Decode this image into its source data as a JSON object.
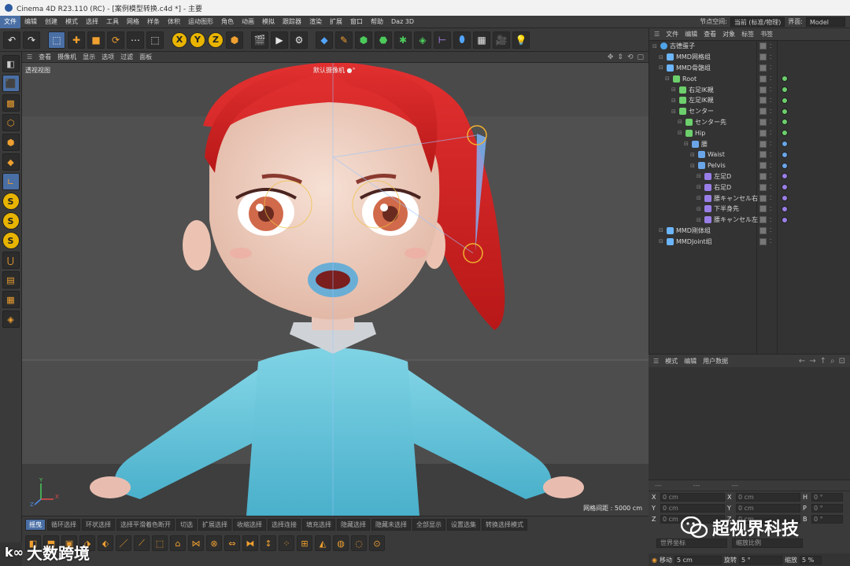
{
  "window": {
    "title": "Cinema 4D R23.110 (RC) - [案例模型转换.c4d *] - 主要"
  },
  "menu": {
    "items": [
      "文件",
      "编辑",
      "创建",
      "模式",
      "选择",
      "工具",
      "网格",
      "样条",
      "体积",
      "运动图形",
      "角色",
      "动画",
      "模拟",
      "跟踪器",
      "渲染",
      "扩展",
      "窗口",
      "帮助",
      "Daz 3D"
    ],
    "node_space_label": "节点空间:",
    "node_space_value": "当前 (标准/物理)",
    "layout_label": "界面:",
    "layout_value": "Model"
  },
  "viewport": {
    "menu": [
      "查看",
      "摄像机",
      "显示",
      "选项",
      "过滤",
      "面板"
    ],
    "label": "透视视图",
    "camera": "默认摄像机 ●°",
    "grid_info": "网格间距 : 5000 cm",
    "axis_y": "Y",
    "axis_x": "X",
    "axis_z": "Z"
  },
  "object_manager": {
    "menu": [
      "文件",
      "编辑",
      "查看",
      "对象",
      "标签",
      "书签"
    ],
    "rows": [
      {
        "label": "古德蛋子",
        "icon": "null",
        "indent": 0
      },
      {
        "label": "MMD网格组",
        "icon": "grp",
        "indent": 1
      },
      {
        "label": "MMD骨骼组",
        "icon": "grp",
        "indent": 1
      },
      {
        "label": "Root",
        "icon": "bone",
        "indent": 2
      },
      {
        "label": "右足IK親",
        "icon": "bone",
        "indent": 3
      },
      {
        "label": "左足IK親",
        "icon": "bone",
        "indent": 3
      },
      {
        "label": "センター",
        "icon": "bone",
        "indent": 3
      },
      {
        "label": "センター先",
        "icon": "bone",
        "indent": 4
      },
      {
        "label": "Hip",
        "icon": "bone",
        "indent": 4
      },
      {
        "label": "腰",
        "icon": "bone2",
        "indent": 5
      },
      {
        "label": "Waist",
        "icon": "bone2",
        "indent": 6
      },
      {
        "label": "Pelvis",
        "icon": "bone2",
        "indent": 6
      },
      {
        "label": "左足D",
        "icon": "bone3",
        "indent": 7
      },
      {
        "label": "右足D",
        "icon": "bone3",
        "indent": 7
      },
      {
        "label": "腰キャンセル右",
        "icon": "bone3",
        "indent": 7
      },
      {
        "label": "下半身先",
        "icon": "bone3",
        "indent": 7
      },
      {
        "label": "腰キャンセル左",
        "icon": "bone3",
        "indent": 7
      },
      {
        "label": "MMD刚体组",
        "icon": "grp",
        "indent": 1
      },
      {
        "label": "MMDJoint组",
        "icon": "grp",
        "indent": 1
      }
    ]
  },
  "attributes": {
    "menu": [
      "模式",
      "编辑",
      "用户数据"
    ]
  },
  "coordinates": {
    "rows": [
      {
        "a": "X",
        "av": "0 cm",
        "b": "X",
        "bv": "0 cm",
        "c": "H",
        "cv": "0 °"
      },
      {
        "a": "Y",
        "av": "0 cm",
        "b": "Y",
        "bv": "0 cm",
        "c": "P",
        "cv": "0 °"
      },
      {
        "a": "Z",
        "av": "0 cm",
        "b": "Z",
        "bv": "0 cm",
        "c": "B",
        "cv": "0 °"
      }
    ],
    "world_dropdown": "世界坐标",
    "scale_dropdown": "缩放比例",
    "move_label": "移动",
    "move_value": "5 cm",
    "rotate_label": "旋转",
    "rotate_value": "5 °",
    "scale_label": "缩放",
    "scale_value": "5 %"
  },
  "bottom_tabs": [
    "摇曳",
    "循环选择",
    "环状选择",
    "选择平滑着色断开",
    "切选",
    "扩展选择",
    "收缩选择",
    "选择连接",
    "填充选择",
    "隐藏选择",
    "隐藏未选择",
    "全部显示",
    "设置选集",
    "转换选择模式"
  ],
  "watermark": {
    "brand": "超视界科技",
    "logo2": "大数跨境"
  }
}
